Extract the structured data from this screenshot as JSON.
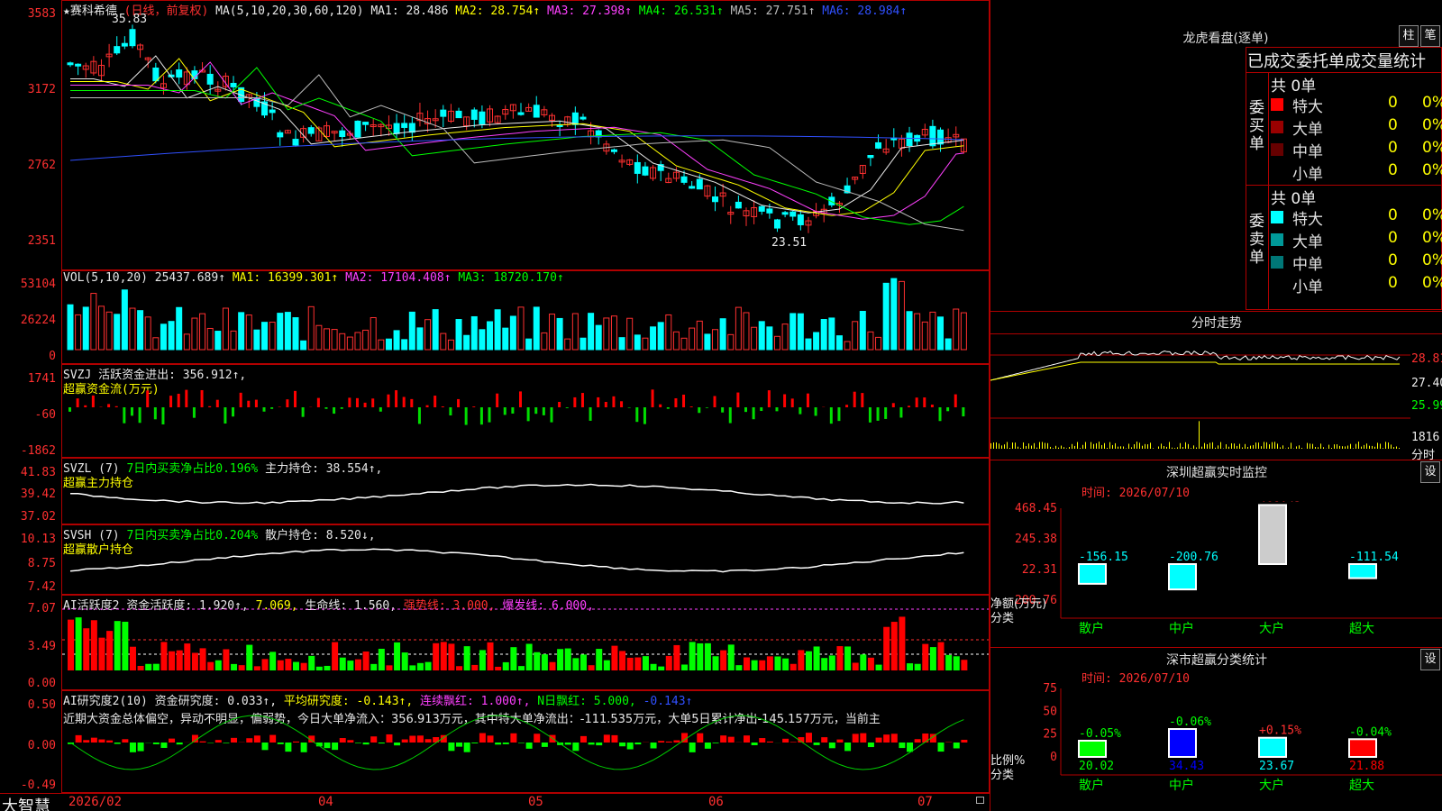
{
  "app": {
    "brand": "大智慧"
  },
  "main_chart": {
    "title": "★赛科希德",
    "mode": "(日线，前复权)",
    "ma_header": "MA(5,10,20,30,60,120)",
    "ma": [
      {
        "label": "MA1: 28.486",
        "color": "#e8e8e8"
      },
      {
        "label": "MA2: 28.754↑",
        "color": "#ffff00"
      },
      {
        "label": "MA3: 27.398↑",
        "color": "#ff40ff"
      },
      {
        "label": "MA4: 26.531↑",
        "color": "#00ff00"
      },
      {
        "label": "MA5: 27.751↑",
        "color": "#bbbbbb"
      },
      {
        "label": "MA6: 28.984↑",
        "color": "#3050ff"
      }
    ],
    "y_ticks": [
      "3583",
      "3172",
      "2762",
      "2351"
    ],
    "high_label": "35.83",
    "low_label": "23.51"
  },
  "vol": {
    "header": "VOL(5,10,20)",
    "value": "25437.689↑",
    "ma1": "MA1: 16399.301↑",
    "ma2": "MA2: 17104.408↑",
    "ma3": "MA3: 18720.170↑",
    "y_ticks": [
      "53104",
      "26224",
      "0"
    ]
  },
  "svzj": {
    "header": "SVZJ",
    "line1": "活跃资金进出: 356.912↑,",
    "line2": "超赢资金流(万元)",
    "y_ticks": [
      "1741",
      "-60",
      "-1862"
    ]
  },
  "svzl": {
    "header": "SVZL (7)",
    "desc": "7日内买卖净占比0.196%",
    "value": "主力持仓: 38.554↑,",
    "line2": "超赢主力持仓",
    "y_ticks": [
      "41.83",
      "39.42",
      "37.02"
    ]
  },
  "svsh": {
    "header": "SVSH (7)",
    "desc": "7日内买卖净占比0.204%",
    "value": "散户持仓: 8.520↓,",
    "line2": "超赢散户持仓",
    "y_ticks": [
      "10.13",
      "8.75",
      "7.42"
    ]
  },
  "ai_active": {
    "header": "AI活跃度2",
    "v1": "资金活跃度: 1.920↑,",
    "v2": "7.069,",
    "v3": "生命线: 1.560,",
    "v4": "强势线: 3.000,",
    "v5": "爆发线: 6.000,",
    "y_ticks": [
      "7.07",
      "3.49",
      "0.00"
    ]
  },
  "ai_research": {
    "header": "AI研究度2(10)",
    "v1": "资金研究度: 0.033↑,",
    "v2": "平均研究度: -0.143↑,",
    "v3": "连续飘红: 1.000↑,",
    "v4": "N日飘红: 5.000,",
    "v5": "-0.143↑",
    "summary": "近期大资金总体偏空，异动不明显，偏弱势，今日大单净流入：356.913万元，其中特大单净流出：-111.535万元，大单5日累计净出-145.157万元，当前主",
    "y_ticks": [
      "0.50",
      "0.00",
      "-0.49"
    ]
  },
  "x_axis": [
    "2026/02",
    "04",
    "05",
    "06",
    "07"
  ],
  "right": {
    "dragon_title": "龙虎看盘(逐单)",
    "btn_zhu": "柱",
    "btn_bi": "笔",
    "stats_title": "已成交委托单成交量统计",
    "buy_side": {
      "side_label": "委买单",
      "total": "共 0单",
      "rows": [
        {
          "label": "特大",
          "count": "0",
          "pct": "0%",
          "color": "#ff0000"
        },
        {
          "label": "大单",
          "count": "0",
          "pct": "0%",
          "color": "#990000"
        },
        {
          "label": "中单",
          "count": "0",
          "pct": "0%",
          "color": "#660000"
        },
        {
          "label": "小单",
          "count": "0",
          "pct": "0%",
          "color": "#000000"
        }
      ]
    },
    "sell_side": {
      "side_label": "委卖单",
      "total": "共 0单",
      "rows": [
        {
          "label": "特大",
          "count": "0",
          "pct": "0%",
          "color": "#00ffff"
        },
        {
          "label": "大单",
          "count": "0",
          "pct": "0%",
          "color": "#009999"
        },
        {
          "label": "中单",
          "count": "0",
          "pct": "0%",
          "color": "#007777"
        },
        {
          "label": "小单",
          "count": "0",
          "pct": "0%",
          "color": "#000000"
        }
      ]
    },
    "intraday_title": "分时走势",
    "intraday_ticks": [
      "28.81",
      "27.40",
      "25.99",
      "1816",
      "分时"
    ],
    "monitor": {
      "title": "深圳超赢实时监控",
      "btn": "设",
      "date": "时间: 2026/07/10",
      "y_ticks": [
        "468.45",
        "245.38",
        "22.31",
        "-200.76"
      ],
      "ylabel": "净额(万元)",
      "xlabel": "分类",
      "categories": [
        "散户",
        "中户",
        "大户",
        "超大"
      ],
      "values": [
        "-156.15",
        "-200.76",
        "468.45",
        "-111.54"
      ]
    },
    "classify": {
      "title": "深市超赢分类统计",
      "btn": "设",
      "date": "时间: 2026/07/10",
      "y_ticks": [
        "75",
        "50",
        "25",
        "0"
      ],
      "ylabel": "比例%",
      "xlabel": "分类",
      "categories": [
        "散户",
        "中户",
        "大户",
        "超大"
      ],
      "changes": [
        "-0.05%",
        "-0.06%",
        "+0.15%",
        "-0.04%"
      ],
      "values": [
        "20.02",
        "34.43",
        "23.67",
        "21.88"
      ]
    }
  }
}
